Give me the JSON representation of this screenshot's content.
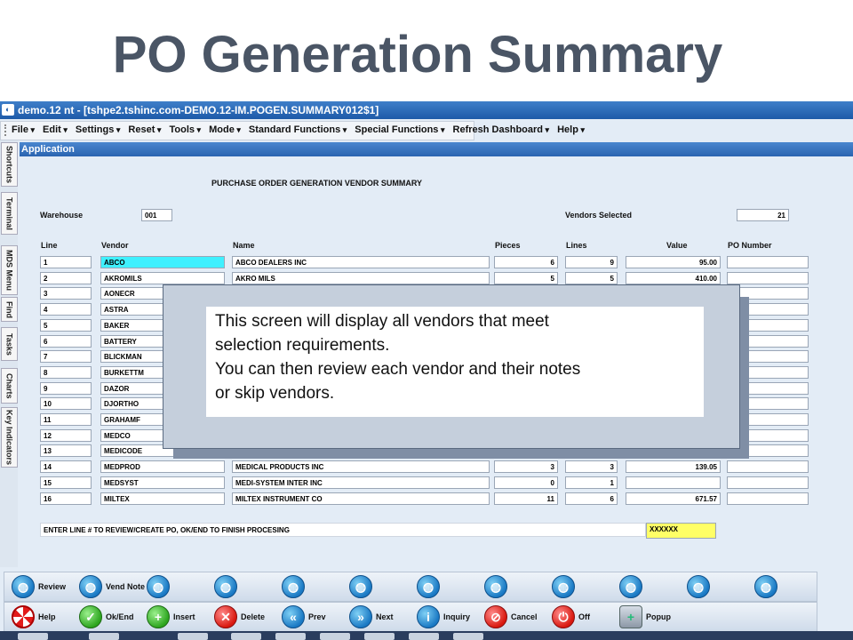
{
  "slide": {
    "title": "PO Generation Summary"
  },
  "window": {
    "title": "demo.12 nt - [tshpe2.tshinc.com-DEMO.12-IM.POGEN.SUMMARY012$1]",
    "app_icon": "app-logo-icon"
  },
  "menu": [
    "File",
    "Edit",
    "Settings",
    "Reset",
    "Tools",
    "Mode",
    "Standard Functions",
    "Special Functions",
    "Refresh Dashboard",
    "Help"
  ],
  "side_tabs": [
    "Shortcuts",
    "Terminal",
    "MDS Menu",
    "Find",
    "Tasks",
    "Charts",
    "Key Indicators"
  ],
  "app_header": "Application",
  "form": {
    "heading": "PURCHASE ORDER GENERATION VENDOR SUMMARY",
    "warehouse_label": "Warehouse",
    "warehouse_value": "001",
    "vendors_selected_label": "Vendors Selected",
    "vendors_selected_value": "21",
    "columns": [
      "Line",
      "Vendor",
      "Name",
      "Pieces",
      "Lines",
      "Value",
      "PO Number"
    ],
    "rows": [
      {
        "line": "1",
        "vendor": "ABCO",
        "name": "ABCO DEALERS INC",
        "pieces": "6",
        "lines": "9",
        "value": "95.00",
        "po": ""
      },
      {
        "line": "2",
        "vendor": "AKROMILS",
        "name": "AKRO MILS",
        "pieces": "5",
        "lines": "5",
        "value": "410.00",
        "po": ""
      },
      {
        "line": "3",
        "vendor": "AONECR",
        "name": "",
        "pieces": "",
        "lines": "",
        "value": "",
        "po": ""
      },
      {
        "line": "4",
        "vendor": "ASTRA",
        "name": "",
        "pieces": "",
        "lines": "",
        "value": "",
        "po": ""
      },
      {
        "line": "5",
        "vendor": "BAKER",
        "name": "",
        "pieces": "",
        "lines": "",
        "value": "",
        "po": ""
      },
      {
        "line": "6",
        "vendor": "BATTERY",
        "name": "",
        "pieces": "",
        "lines": "",
        "value": "",
        "po": ""
      },
      {
        "line": "7",
        "vendor": "BLICKMAN",
        "name": "",
        "pieces": "",
        "lines": "",
        "value": "",
        "po": ""
      },
      {
        "line": "8",
        "vendor": "BURKETTM",
        "name": "",
        "pieces": "",
        "lines": "",
        "value": "",
        "po": ""
      },
      {
        "line": "9",
        "vendor": "DAZOR",
        "name": "",
        "pieces": "",
        "lines": "",
        "value": "",
        "po": ""
      },
      {
        "line": "10",
        "vendor": "DJORTHO",
        "name": "",
        "pieces": "",
        "lines": "",
        "value": "",
        "po": ""
      },
      {
        "line": "11",
        "vendor": "GRAHAMF",
        "name": "",
        "pieces": "",
        "lines": "",
        "value": "",
        "po": ""
      },
      {
        "line": "12",
        "vendor": "MEDCO",
        "name": "",
        "pieces": "",
        "lines": "",
        "value": "",
        "po": ""
      },
      {
        "line": "13",
        "vendor": "MEDICODE",
        "name": "",
        "pieces": "",
        "lines": "",
        "value": "",
        "po": ""
      },
      {
        "line": "14",
        "vendor": "MEDPROD",
        "name": "MEDICAL PRODUCTS INC",
        "pieces": "3",
        "lines": "3",
        "value": "139.05",
        "po": ""
      },
      {
        "line": "15",
        "vendor": "MEDSYST",
        "name": "MEDI-SYSTEM INTER INC",
        "pieces": "0",
        "lines": "1",
        "value": "",
        "po": ""
      },
      {
        "line": "16",
        "vendor": "MILTEX",
        "name": "MILTEX INSTRUMENT CO",
        "pieces": "11",
        "lines": "6",
        "value": "671.57",
        "po": ""
      }
    ],
    "prompt": "ENTER LINE # TO REVIEW/CREATE PO, OK/END TO FINISH PROCESING",
    "input_value": "XXXXXX"
  },
  "overlay": {
    "line1": "This screen will display all vendors that meet",
    "line2": "selection requirements.",
    "line3": "You can then review each vendor and their notes",
    "line4": "or skip vendors."
  },
  "function_bar_1": [
    {
      "label": "Review",
      "icon": "globe-icon"
    },
    {
      "label": "Vend Note",
      "icon": "globe-icon"
    },
    {
      "label": "",
      "icon": "globe-icon"
    },
    {
      "label": "",
      "icon": "globe-icon"
    },
    {
      "label": "",
      "icon": "globe-icon"
    },
    {
      "label": "",
      "icon": "globe-icon"
    },
    {
      "label": "",
      "icon": "globe-icon"
    },
    {
      "label": "",
      "icon": "globe-icon"
    },
    {
      "label": "",
      "icon": "globe-icon"
    },
    {
      "label": "",
      "icon": "globe-icon"
    },
    {
      "label": "",
      "icon": "globe-icon"
    },
    {
      "label": "",
      "icon": "globe-icon"
    }
  ],
  "function_bar_2": [
    {
      "label": "Help",
      "icon": "lifebuoy-icon"
    },
    {
      "label": "Ok/End",
      "icon": "check-icon"
    },
    {
      "label": "Insert",
      "icon": "plus-icon"
    },
    {
      "label": "Delete",
      "icon": "x-icon"
    },
    {
      "label": "Prev",
      "icon": "rewind-icon"
    },
    {
      "label": "Next",
      "icon": "fast-forward-icon"
    },
    {
      "label": "Inquiry",
      "icon": "info-icon"
    },
    {
      "label": "Cancel",
      "icon": "no-entry-icon"
    },
    {
      "label": "Off",
      "icon": "power-icon"
    },
    {
      "label": "Popup",
      "icon": "database-icon"
    }
  ]
}
